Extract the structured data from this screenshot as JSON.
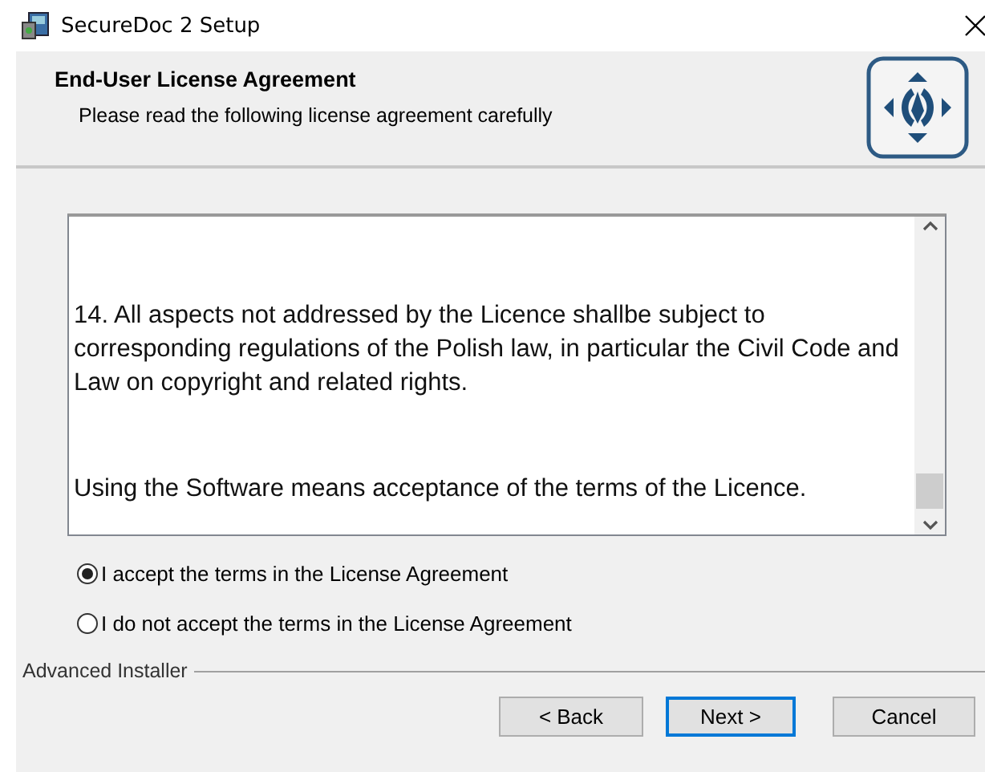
{
  "window": {
    "title": "SecureDoc 2 Setup"
  },
  "header": {
    "title": "End-User License Agreement",
    "subtitle": "Please read the following license agreement carefully"
  },
  "license": {
    "paragraphs": [
      "14. All aspects not addressed by the Licence shallbe subject to corresponding regulations of the Polish law, in particular the Civil Code and Law on copyright and related rights.",
      "Using the Software means acceptance of the terms of the Licence."
    ]
  },
  "options": [
    {
      "label": "I accept the terms in the License Agreement",
      "selected": true
    },
    {
      "label": "I do not accept the terms in the License Agreement",
      "selected": false
    }
  ],
  "footer": {
    "brand": "Advanced Installer"
  },
  "buttons": [
    {
      "label": "< Back",
      "default": false
    },
    {
      "label": "Next >",
      "default": true
    },
    {
      "label": "Cancel",
      "default": false
    }
  ]
}
